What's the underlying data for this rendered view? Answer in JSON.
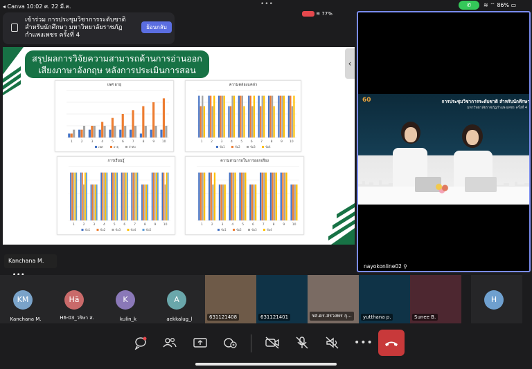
{
  "status_bar": {
    "left": "◂ Canva  10:02  ศ. 22 มี.ค.",
    "battery": "86%"
  },
  "banner": {
    "text": "เข้าร่วม การประชุมวิชาการระดับชาติสำหรับนักศึกษา มหาวิทยาลัยราชภัฏกำแพงเพชร ครั้งที่ 4",
    "button": "ย้อนกลับ"
  },
  "share_tray": {
    "battery_small": "77%"
  },
  "slide": {
    "title_line1": "สรุปผลการวิจัยความสามารถด้านการอ่านออก",
    "title_line2": "เสียงภาษาอังกฤษ หลังการประเมินการสอน"
  },
  "presenter": {
    "name": "Kanchana M.",
    "more": "•••"
  },
  "speaker": {
    "logo": "60",
    "video_title": "การประชุมวิชาการระดับชาติ สำหรับนักศึกษา",
    "video_subtitle": "มหาวิทยาลัยราชภัฏกำแพงเพชร ครั้งที่ 4",
    "name": "nayokonline02"
  },
  "participants": [
    {
      "initials": "KM",
      "name": "Kanchana M.",
      "color": "#7aa3c9",
      "type": "avatar"
    },
    {
      "initials": "Hā",
      "name": "H6-03_วริษา ส.",
      "color": "#c96a6a",
      "type": "avatar"
    },
    {
      "initials": "K",
      "name": "kulin_k",
      "color": "#8a78b8",
      "type": "avatar"
    },
    {
      "initials": "A",
      "name": "aekkalug_l",
      "color": "#6aa7ab",
      "type": "avatar"
    },
    {
      "initials": "",
      "name": "631121408",
      "color": "#6e5a48",
      "type": "video"
    },
    {
      "initials": "",
      "name": "631121401",
      "color": "#0f3347",
      "type": "video"
    },
    {
      "initials": "",
      "name": "รศ.ดร.สรวงพร กุ...",
      "color": "#7a6b63",
      "type": "video"
    },
    {
      "initials": "",
      "name": "yutthana p.",
      "color": "#0f3347",
      "type": "video"
    },
    {
      "initials": "",
      "name": "Sunee B.",
      "color": "#4d2730",
      "type": "video"
    },
    {
      "initials": "H",
      "name": "",
      "color": "#6fa0cf",
      "type": "avatar"
    }
  ],
  "toolbar": {
    "buttons": [
      "chat-icon",
      "participants-icon",
      "share-screen-icon",
      "reactions-icon",
      "camera-off-icon",
      "mic-off-icon",
      "speaker-off-icon",
      "more-icon",
      "end-call-icon"
    ]
  },
  "chart_data": [
    {
      "type": "bar",
      "title": "เพศ อายุ",
      "categories": [
        "1",
        "2",
        "3",
        "4",
        "5",
        "6",
        "7",
        "8",
        "9",
        "10"
      ],
      "series": [
        {
          "name": "เพศ",
          "values": [
            1,
            2,
            2,
            2,
            2,
            2,
            2,
            1,
            2,
            2
          ]
        },
        {
          "name": "อายุ",
          "values": [
            1,
            2,
            3,
            4,
            5,
            6,
            7,
            8,
            9,
            10
          ]
        },
        {
          "name": "ลำดับ",
          "values": [
            2,
            3,
            3,
            3,
            3,
            3,
            3,
            3,
            3,
            3
          ]
        }
      ],
      "ylim": [
        0,
        12
      ]
    },
    {
      "type": "bar",
      "title": "ความคล่องแคล่ว",
      "categories": [
        "1",
        "2",
        "3",
        "4",
        "5",
        "6",
        "7",
        "8",
        "9",
        "10"
      ],
      "series": [
        {
          "name": "ข้อ1",
          "values": [
            4,
            4,
            4,
            3,
            4,
            4,
            4,
            4,
            4,
            4
          ]
        },
        {
          "name": "ข้อ2",
          "values": [
            3,
            4,
            4,
            3,
            4,
            4,
            3,
            4,
            4,
            4
          ]
        },
        {
          "name": "ข้อ3",
          "values": [
            4,
            3,
            4,
            4,
            4,
            3,
            4,
            4,
            4,
            3
          ]
        },
        {
          "name": "ข้อ4",
          "values": [
            3,
            4,
            4,
            4,
            3,
            4,
            4,
            3,
            4,
            4
          ]
        }
      ],
      "ylim": [
        0,
        4.5
      ]
    },
    {
      "type": "bar",
      "title": "การเรียนรู้",
      "categories": [
        "1",
        "2",
        "3",
        "4",
        "5",
        "6",
        "7",
        "8",
        "9",
        "10"
      ],
      "series": [
        {
          "name": "ข้อ1",
          "values": [
            4,
            4,
            3,
            4,
            4,
            4,
            4,
            3,
            4,
            4
          ]
        },
        {
          "name": "ข้อ2",
          "values": [
            4,
            4,
            3,
            4,
            4,
            4,
            4,
            3,
            4,
            4
          ]
        },
        {
          "name": "ข้อ3",
          "values": [
            4,
            3,
            3,
            4,
            4,
            4,
            4,
            3,
            4,
            3
          ]
        },
        {
          "name": "ข้อ4",
          "values": [
            4,
            4,
            3,
            4,
            4,
            4,
            4,
            3,
            4,
            4
          ]
        },
        {
          "name": "ข้อ5",
          "values": [
            4,
            4,
            3,
            4,
            4,
            4,
            4,
            3,
            4,
            4
          ]
        }
      ],
      "ylim": [
        0,
        4.5
      ]
    },
    {
      "type": "bar",
      "title": "ความสามารถในการออกเสียง",
      "categories": [
        "1",
        "2",
        "3",
        "4",
        "5",
        "6",
        "7",
        "8",
        "9",
        "10"
      ],
      "series": [
        {
          "name": "ข้อ1",
          "values": [
            4,
            4,
            3,
            4,
            4,
            3,
            4,
            4,
            4,
            3
          ]
        },
        {
          "name": "ข้อ2",
          "values": [
            4,
            4,
            3,
            4,
            4,
            3,
            4,
            4,
            4,
            3
          ]
        },
        {
          "name": "ข้อ3",
          "values": [
            4,
            3,
            3,
            4,
            4,
            3,
            4,
            4,
            4,
            3
          ]
        },
        {
          "name": "ข้อ4",
          "values": [
            4,
            4,
            3,
            4,
            4,
            3,
            4,
            4,
            4,
            3
          ]
        }
      ],
      "ylim": [
        0,
        4.5
      ]
    }
  ]
}
